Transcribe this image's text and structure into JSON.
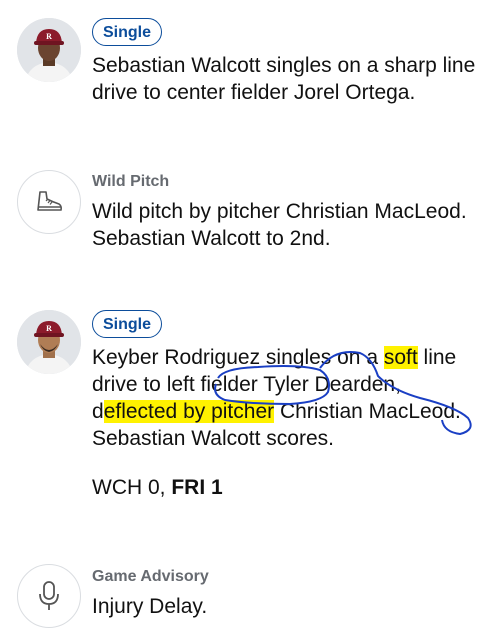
{
  "plays": [
    {
      "type_label": "Single",
      "description": "Sebastian Walcott singles on a sharp line drive to center fielder Jorel Ortega."
    },
    {
      "type_label": "Wild Pitch",
      "icon": "shoe-icon",
      "description": "Wild pitch by pitcher Christian MacLeod. Sebastian Walcott to 2nd."
    },
    {
      "type_label": "Single",
      "description_parts": {
        "p1": "Keyber Rodriguez singles on a ",
        "p2": "soft",
        "p3": " line drive to ",
        "p4": "left fielder",
        "p5": " Tyler Dearden, d",
        "p6": "eflected by pitcher",
        "p7": " Christian MacLeod. Sebastian Walcott scores."
      },
      "score": {
        "away": "WCH 0,",
        "home": "FRI 1"
      }
    },
    {
      "type_label": "Game Advisory",
      "icon": "microphone-icon",
      "description": "Injury Delay."
    }
  ],
  "colors": {
    "badge_blue": "#0c4d9b",
    "highlight": "#fff200",
    "ink": "#1a3fc4",
    "cap_red": "#8c1b2b"
  }
}
